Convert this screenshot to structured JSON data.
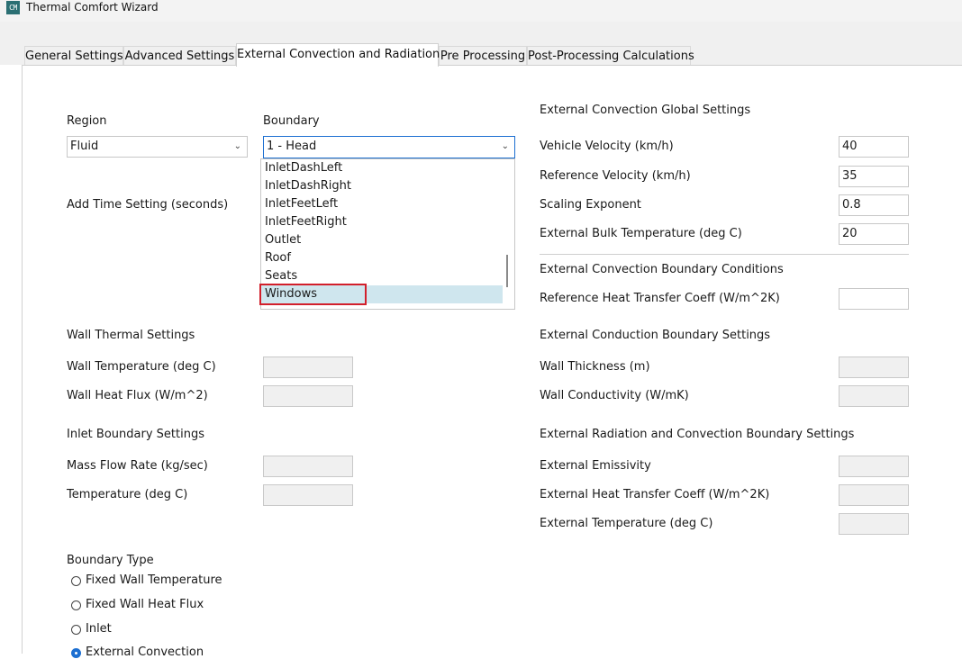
{
  "window": {
    "app_icon_text": "CM",
    "title": "Thermal Comfort Wizard"
  },
  "tabs": [
    {
      "label": "General Settings"
    },
    {
      "label": "Advanced Settings"
    },
    {
      "label": "External Convection and Radiation",
      "active": true
    },
    {
      "label": "Pre Processing"
    },
    {
      "label": "Post-Processing Calculations"
    }
  ],
  "region": {
    "label": "Region",
    "value": "Fluid"
  },
  "boundary": {
    "label": "Boundary",
    "value": "1 - Head",
    "dropdown_items": [
      "InletDashLeft",
      "InletDashRight",
      "InletFeetLeft",
      "InletFeetRight",
      "Outlet",
      "Roof",
      "Seats",
      "Windows"
    ],
    "highlighted_item": "Windows"
  },
  "add_time": {
    "label": "Add Time Setting (seconds)"
  },
  "wall_thermal": {
    "section": "Wall Thermal Settings",
    "temperature_label": "Wall Temperature (deg C)",
    "heat_flux_label": "Wall Heat Flux (W/m^2)",
    "temperature_value": "",
    "heat_flux_value": ""
  },
  "inlet": {
    "section": "Inlet Boundary Settings",
    "mass_flow_label": "Mass Flow Rate (kg/sec)",
    "temperature_label": "Temperature (deg C)",
    "mass_flow_value": "",
    "temperature_value": ""
  },
  "boundary_type": {
    "section": "Boundary Type",
    "options": [
      "Fixed Wall Temperature",
      "Fixed Wall Heat Flux",
      "Inlet",
      "External Convection"
    ],
    "selected": "External Convection"
  },
  "ext_conv_global": {
    "section": "External Convection Global Settings",
    "vehicle_velocity_label": "Vehicle Velocity (km/h)",
    "vehicle_velocity": "40",
    "reference_velocity_label": "Reference Velocity (km/h)",
    "reference_velocity": "35",
    "scaling_exponent_label": "Scaling Exponent",
    "scaling_exponent": "0.8",
    "bulk_temp_label": "External Bulk Temperature (deg C)",
    "bulk_temp": "20"
  },
  "ext_conv_bc": {
    "section": "External Convection Boundary Conditions",
    "ref_htc_label": "Reference Heat Transfer Coeff (W/m^2K)",
    "ref_htc": ""
  },
  "ext_conduction": {
    "section": "External Conduction Boundary Settings",
    "thickness_label": "Wall Thickness (m)",
    "conductivity_label": "Wall Conductivity (W/mK)",
    "thickness": "",
    "conductivity": ""
  },
  "ext_rad_conv": {
    "section": "External Radiation and Convection Boundary Settings",
    "emissivity_label": "External Emissivity",
    "htc_label": "External Heat Transfer Coeff (W/m^2K)",
    "temperature_label": "External Temperature (deg C)",
    "emissivity": "",
    "htc": "",
    "temperature": ""
  },
  "colors": {
    "accent": "#1c6fd1",
    "highlight_box": "#d21f2b",
    "selected_item_bg": "#cfe6ee",
    "tab_strip": "#f0f0f0"
  }
}
